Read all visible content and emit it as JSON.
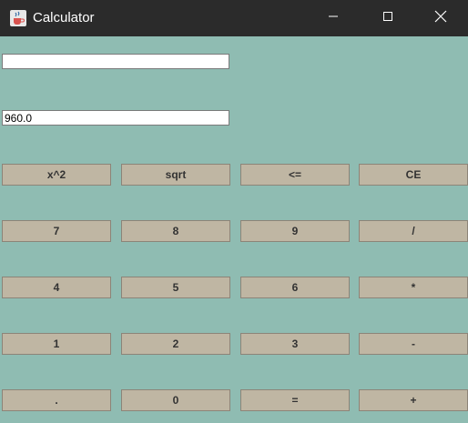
{
  "window": {
    "title": "Calculator",
    "icon": "java-coffee-cup-icon",
    "controls": [
      "minimize-icon",
      "maximize-icon",
      "close-icon"
    ]
  },
  "display": {
    "input_value": "",
    "result_value": "960.0"
  },
  "buttons": {
    "row0": [
      "x^2",
      "sqrt",
      "<=",
      "CE"
    ],
    "row1": [
      "7",
      "8",
      "9",
      "/"
    ],
    "row2": [
      "4",
      "5",
      "6",
      "*"
    ],
    "row3": [
      "1",
      "2",
      "3",
      "-"
    ],
    "row4": [
      ".",
      "0",
      "=",
      "+"
    ]
  },
  "colors": {
    "titlebar": "#2b2b2b",
    "background": "#8fbcb2",
    "button": "#bfb6a3"
  }
}
